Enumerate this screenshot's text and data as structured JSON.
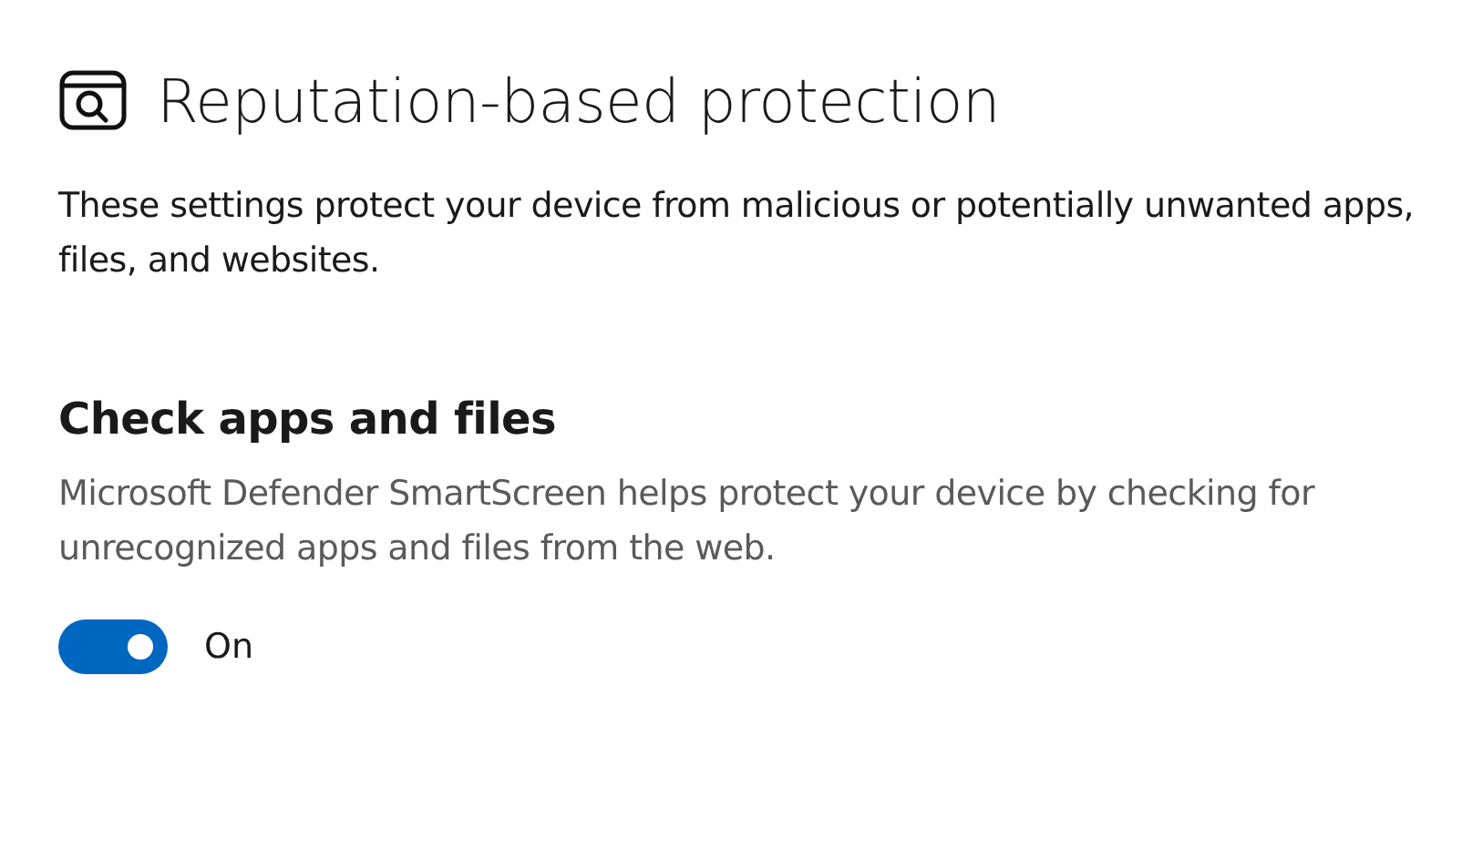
{
  "page": {
    "title": "Reputation-based protection",
    "description": "These settings protect your device from malicious or potentially unwanted apps, files, and websites."
  },
  "section": {
    "heading": "Check apps and files",
    "description": "Microsoft Defender SmartScreen helps protect your device by checking for unrecognized apps and files from the web.",
    "toggle": {
      "on": true,
      "label": "On"
    }
  }
}
